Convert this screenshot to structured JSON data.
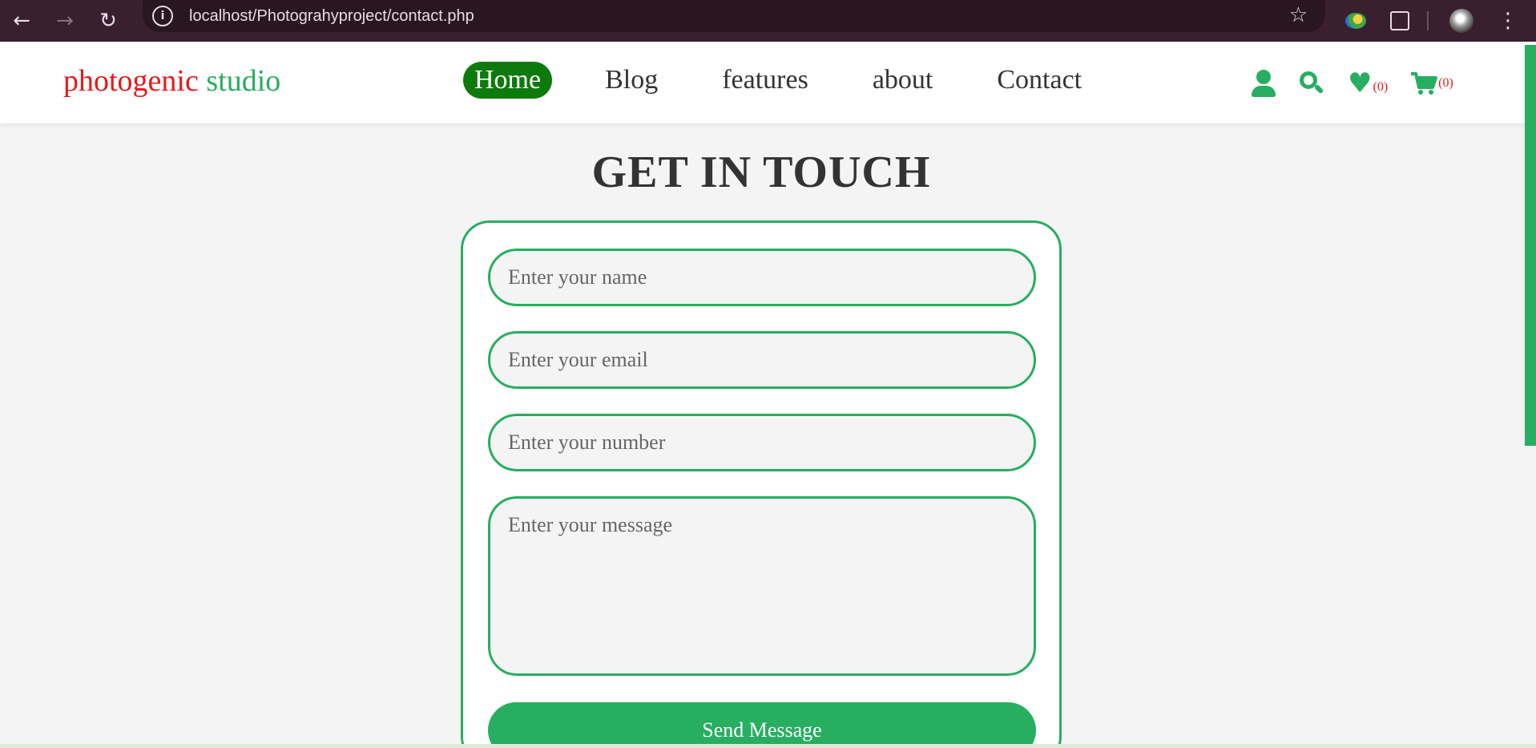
{
  "browser": {
    "url": "localhost/Photograhyproject/contact.php"
  },
  "header": {
    "logo_part1": "photogenic",
    "logo_part2": "studio",
    "nav": [
      {
        "label": "Home",
        "active": true
      },
      {
        "label": "Blog"
      },
      {
        "label": "features"
      },
      {
        "label": "about"
      },
      {
        "label": "Contact"
      }
    ],
    "wishlist_count": "(0)",
    "cart_count": "(0)"
  },
  "contact": {
    "title": "GET IN TOUCH",
    "name_placeholder": "Enter your name",
    "email_placeholder": "Enter your email",
    "number_placeholder": "Enter your number",
    "message_placeholder": "Enter your message",
    "submit_label": "Send Message"
  },
  "colors": {
    "accent": "#27ae60",
    "logo_red": "#e41b17",
    "active_nav": "#0d7a0d",
    "chrome_bg": "#3a1f2e"
  }
}
